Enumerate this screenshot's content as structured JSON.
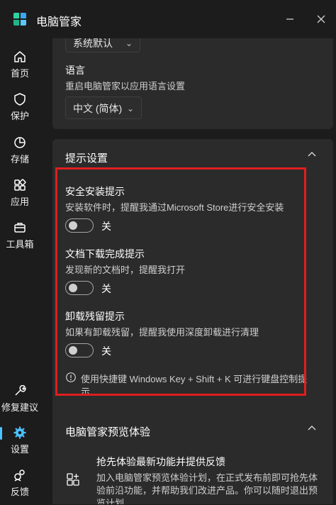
{
  "app": {
    "title": "电脑管家"
  },
  "window_controls": {
    "minimize_icon": "minimize-icon",
    "close_icon": "close-icon"
  },
  "sidebar": {
    "items": [
      {
        "label": "首页",
        "icon": "home-icon"
      },
      {
        "label": "保护",
        "icon": "shield-icon"
      },
      {
        "label": "存储",
        "icon": "pie-chart-icon"
      },
      {
        "label": "应用",
        "icon": "apps-icon"
      },
      {
        "label": "工具箱",
        "icon": "toolbox-icon"
      },
      {
        "label": "修复建议",
        "icon": "wrench-icon"
      },
      {
        "label": "设置",
        "icon": "gear-icon",
        "active": true
      },
      {
        "label": "反馈",
        "icon": "feedback-icon"
      }
    ],
    "accent_color": "#4cc2ff"
  },
  "region_card": {
    "top_select_value": "系统默认",
    "language_title": "语言",
    "language_desc": "重启电脑管家以应用语言设置",
    "language_select_value": "中文 (简体)"
  },
  "tips_section": {
    "title": "提示设置",
    "items": [
      {
        "title": "安全安装提示",
        "desc": "安装软件时，提醒我通过Microsoft Store进行安全安装",
        "toggle_label": "关"
      },
      {
        "title": "文档下载完成提示",
        "desc": "发现新的文档时，提醒我打开",
        "toggle_label": "关"
      },
      {
        "title": "卸载残留提示",
        "desc": "如果有卸载残留，提醒我使用深度卸载进行清理",
        "toggle_label": "关"
      }
    ],
    "shortcut_tip_line1": "使用快捷键 Windows Key + Shift + K 可进行键盘控制提",
    "shortcut_tip_line2": "示",
    "highlight_color": "#e01e1e"
  },
  "preview_section": {
    "title": "电脑管家预览体验",
    "item_title": "抢先体验最新功能并提供反馈",
    "item_desc_line1": "加入电脑管家预览体验计划，在正式发布前即可抢先体",
    "item_desc_line2": "验前沿功能，并帮助我们改进产品。你可以随时退出预",
    "item_desc_line3": "览计划。"
  }
}
